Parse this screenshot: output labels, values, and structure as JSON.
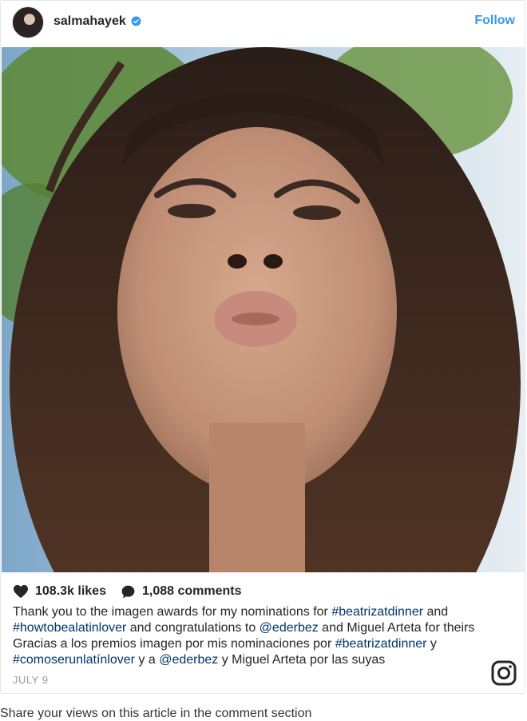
{
  "post": {
    "username": "salmahayek",
    "follow_label": "Follow",
    "likes_label": "108.3k likes",
    "comments_label": "1,088 comments",
    "caption_parts": {
      "p1": "Thank you to the imagen awards for my nominations for ",
      "tag1": "#beatrizatdinner",
      "p2": " and ",
      "tag2": "#howtobealatinlover",
      "p3": " and congratulations to ",
      "mention1": "@ederbez",
      "p4": " and Miguel Arteta for theirs Gracias a los premios imagen por mis nominaciones por ",
      "tag3": "#beatrizatdinner",
      "p5": " y ",
      "tag4": "#comoserunlatínlover",
      "p6": " y a ",
      "mention2": "@ederbez",
      "p7": " y Miguel Arteta por las suyas"
    },
    "date": "JULY 9"
  },
  "page": {
    "below_text": "Share your views on this article in the comment section"
  },
  "icons": {
    "verified": "verified-badge-icon",
    "heart": "heart-icon",
    "comment": "comment-bubble-icon",
    "instagram": "instagram-logo-icon"
  },
  "colors": {
    "link": "#3897f0",
    "hashtag": "#003569",
    "muted": "#999999"
  }
}
